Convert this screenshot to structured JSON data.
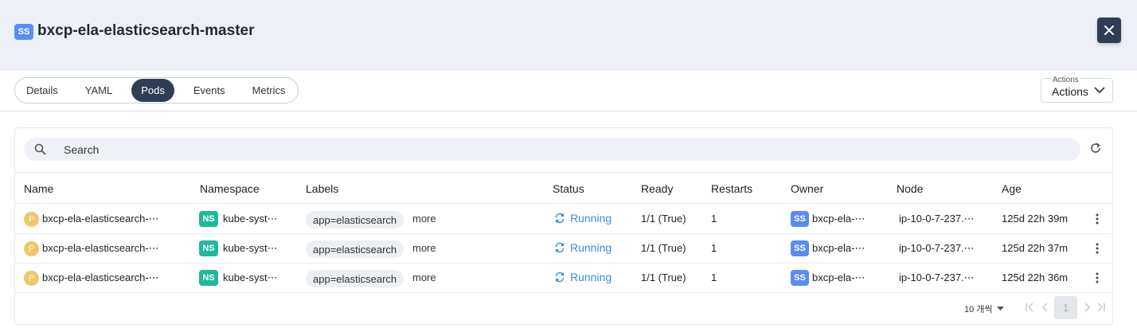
{
  "header": {
    "kind_badge": "SS",
    "title": "bxcp-ela-elasticsearch-master",
    "close_icon": "close-icon"
  },
  "tabs": [
    "Details",
    "YAML",
    "Pods",
    "Events",
    "Metrics"
  ],
  "active_tab": "Pods",
  "actions": {
    "legend": "Actions",
    "value": "Actions"
  },
  "search": {
    "placeholder": "Search"
  },
  "columns": [
    "Name",
    "Namespace",
    "Labels",
    "Status",
    "Ready",
    "Restarts",
    "Owner",
    "Node",
    "Age"
  ],
  "rows": [
    {
      "kind": "P",
      "name": "bxcp-ela-elasticsearch-⋯",
      "ns_badge": "NS",
      "namespace": "kube-syst⋯",
      "label": "app=elasticsearch",
      "more": "more",
      "status": "Running",
      "ready": "1/1 (True)",
      "restarts": "1",
      "owner_badge": "SS",
      "owner": "bxcp-ela-⋯",
      "node": "ip-10-0-7-237.⋯",
      "age": "125d 22h 39m"
    },
    {
      "kind": "P",
      "name": "bxcp-ela-elasticsearch-⋯",
      "ns_badge": "NS",
      "namespace": "kube-syst⋯",
      "label": "app=elasticsearch",
      "more": "more",
      "status": "Running",
      "ready": "1/1 (True)",
      "restarts": "1",
      "owner_badge": "SS",
      "owner": "bxcp-ela-⋯",
      "node": "ip-10-0-7-237.⋯",
      "age": "125d 22h 37m"
    },
    {
      "kind": "P",
      "name": "bxcp-ela-elasticsearch-⋯",
      "ns_badge": "NS",
      "namespace": "kube-syst⋯",
      "label": "app=elasticsearch",
      "more": "more",
      "status": "Running",
      "ready": "1/1 (True)",
      "restarts": "1",
      "owner_badge": "SS",
      "owner": "bxcp-ela-⋯",
      "node": "ip-10-0-7-237.⋯",
      "age": "125d 22h 36m"
    }
  ],
  "footer": {
    "page_size": "10 개씩",
    "current_page": "1"
  },
  "colors": {
    "accent_dark": "#2f3e55",
    "ss_badge": "#5b8def",
    "ns_badge": "#20b89a",
    "pod_badge": "#f2c667",
    "running": "#3b8ce0"
  }
}
